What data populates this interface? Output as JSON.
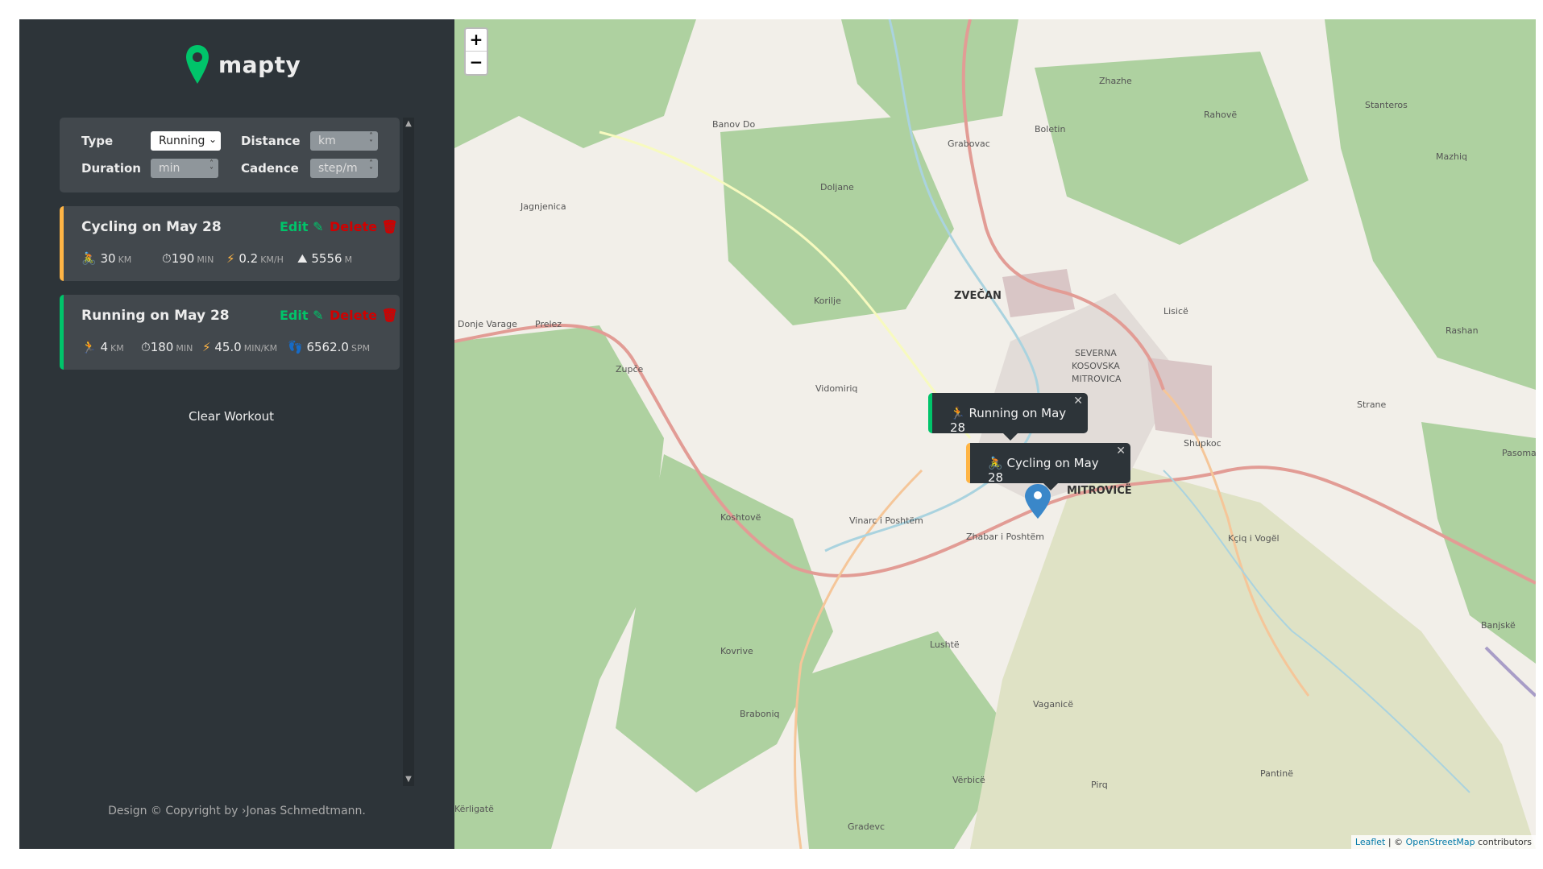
{
  "app": {
    "name": "mapty",
    "brand_color": "#00c46a"
  },
  "form": {
    "type_label": "Type",
    "type_value": "Running",
    "distance_label": "Distance",
    "distance_placeholder": "km",
    "duration_label": "Duration",
    "duration_placeholder": "min",
    "cadence_label": "Cadence",
    "cadence_placeholder": "step/m"
  },
  "workouts": [
    {
      "title": "Cycling on May 28",
      "accent": "#ffb545",
      "edit_label": "Edit",
      "delete_label": "Delete",
      "distance": "30",
      "distance_unit": "KM",
      "duration": "190",
      "duration_unit": "MIN",
      "speed": "0.2",
      "speed_unit": "KM/H",
      "elevation": "5556",
      "elevation_unit": "M"
    },
    {
      "title": "Running on May 28",
      "accent": "#00c46a",
      "edit_label": "Edit",
      "delete_label": "Delete",
      "distance": "4",
      "distance_unit": "KM",
      "duration": "180",
      "duration_unit": "MIN",
      "pace": "45.0",
      "pace_unit": "MIN/KM",
      "cadence": "6562.0",
      "cadence_unit": "SPM"
    }
  ],
  "clear_label": "Clear Workout",
  "footer": "Design © Copyright by ›Jonas Schmedtmann.",
  "map": {
    "zoom_in": "+",
    "zoom_out": "−",
    "popups": [
      {
        "text": "Running on May 28",
        "accent": "#00c46a"
      },
      {
        "text": "Cycling on May 28",
        "accent": "#ffb545"
      }
    ],
    "labels": [
      "ZVEČAN",
      "MITROVICË",
      "SEVERNA",
      "KOSOVSKA",
      "MITROVICA",
      "Shupkoc",
      "Vidomiriq",
      "Korilje",
      "Zupče",
      "Koshtovë",
      "Vinarc i Poshtëm",
      "Zhabar i Poshtëm",
      "Lushtë",
      "Braboniq",
      "Kovrive",
      "Vaganicë",
      "Pirq",
      "Kçiq i Vogël",
      "Pantinë",
      "Rahovë",
      "Lisicë",
      "Boletin",
      "Zhazhe",
      "Grabovac",
      "Doljane",
      "Banov Do",
      "Jagnjenica",
      "Prelez",
      "Donje Varage",
      "Mazhiq",
      "Rashan",
      "Strane",
      "Banjskë",
      "Pasoma",
      "Vërbicë",
      "Gradevc",
      "Kërligatë",
      "Stanteros"
    ],
    "attribution_leaflet": "Leaflet",
    "attribution_sep": " | © ",
    "attribution_osm": "OpenStreetMap",
    "attribution_tail": " contributors"
  }
}
